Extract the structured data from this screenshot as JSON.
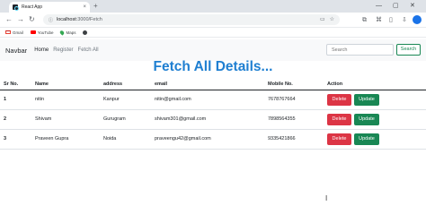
{
  "browser": {
    "tab_title": "React App",
    "tab_close": "×",
    "new_tab": "+",
    "url_host": "localhost",
    "url_path": ":3000/Fetch",
    "controls": {
      "minimize": "—",
      "maximize": "▢",
      "close": "✕"
    },
    "bookmarks": [
      {
        "label": "Gmail",
        "icon": "gmail-icon"
      },
      {
        "label": "YouTube",
        "icon": "youtube-icon"
      },
      {
        "label": "Maps",
        "icon": "maps-icon"
      }
    ]
  },
  "navbar": {
    "brand": "Navbar",
    "links": [
      "Home",
      "Register",
      "Fetch All"
    ],
    "search_placeholder": "Search",
    "search_button": "Search"
  },
  "page": {
    "heading": "Fetch All Details..."
  },
  "table": {
    "headers": [
      "Sr No.",
      "Name",
      "address",
      "email",
      "Mobile No.",
      "Action"
    ],
    "rows": [
      {
        "sr": "1",
        "name": "nitin",
        "address": "Kanpur",
        "email": "nitin@gmail.com",
        "mobile": "7678767664"
      },
      {
        "sr": "2",
        "name": "Shivam",
        "address": "Gurugram",
        "email": "shivam301@gmail.com",
        "mobile": "7898564355"
      },
      {
        "sr": "3",
        "name": "Praveen Gupra",
        "address": "Noida",
        "email": "praveengu42@gmail.com",
        "mobile": "9335421866"
      }
    ],
    "delete_label": "Delete",
    "update_label": "Update",
    "colors": {
      "delete": "#dc3545",
      "update": "#198754",
      "heading": "#1f7fd1"
    }
  }
}
